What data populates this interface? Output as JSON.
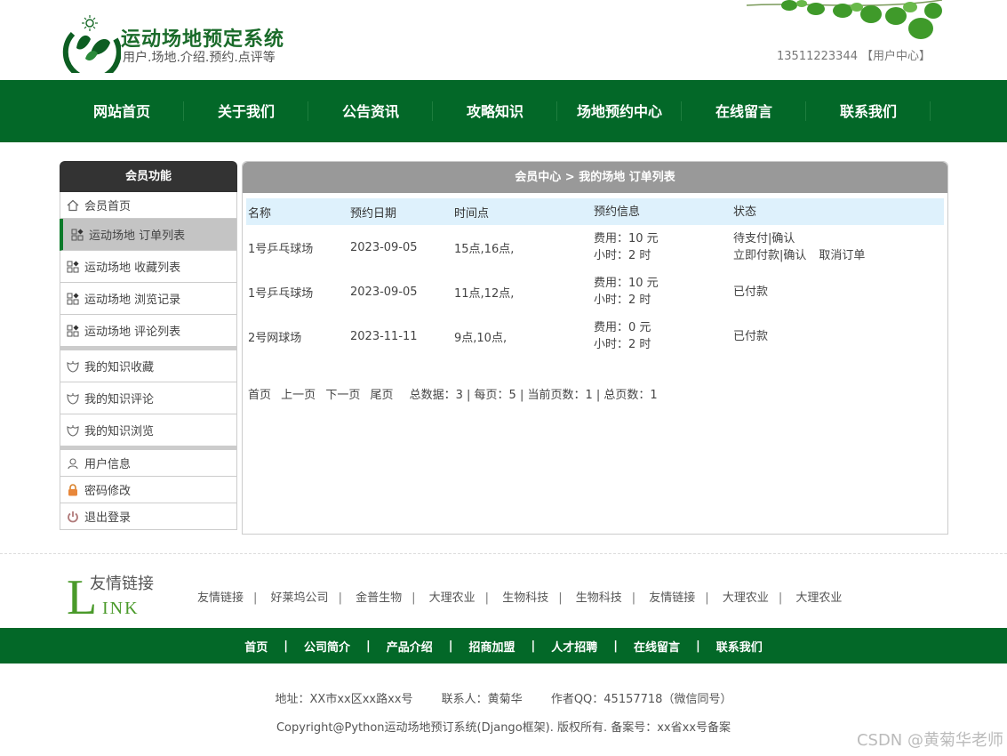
{
  "header": {
    "title": "运动场地预定系统",
    "subtitle": "用户.场地.介绍.预约.点评等",
    "phone": "13511223344",
    "user_center": "【用户中心】"
  },
  "nav": [
    "网站首页",
    "关于我们",
    "公告资讯",
    "攻略知识",
    "场地预约中心",
    "在线留言",
    "联系我们"
  ],
  "sidebar": {
    "title": "会员功能",
    "items": [
      {
        "label": "会员首页",
        "icon": "home-icon"
      },
      {
        "label": "运动场地 订单列表",
        "icon": "grid-icon"
      },
      {
        "label": "运动场地 收藏列表",
        "icon": "grid-icon"
      },
      {
        "label": "运动场地 浏览记录",
        "icon": "grid-icon"
      },
      {
        "label": "运动场地 评论列表",
        "icon": "grid-icon"
      },
      {
        "label": "我的知识收藏",
        "icon": "flower-icon"
      },
      {
        "label": "我的知识评论",
        "icon": "flower-icon"
      },
      {
        "label": "我的知识浏览",
        "icon": "flower-icon"
      },
      {
        "label": "用户信息",
        "icon": "user-icon"
      },
      {
        "label": "密码修改",
        "icon": "lock-icon"
      },
      {
        "label": "退出登录",
        "icon": "power-icon"
      }
    ]
  },
  "panel": {
    "title": "会员中心 > 我的场地 订单列表",
    "columns": [
      "名称",
      "预约日期",
      "时间点",
      "预约信息",
      "状态"
    ],
    "rows": [
      {
        "name": "1号乒乓球场",
        "date": "2023-09-05",
        "time": "15点,16点,",
        "fee": "费用：10 元",
        "hours": "小时：2 时",
        "status": "待支付|确认",
        "action1": "立即付款|确认",
        "action2": "取消订单"
      },
      {
        "name": "1号乒乓球场",
        "date": "2023-09-05",
        "time": "11点,12点,",
        "fee": "费用：10 元",
        "hours": "小时：2 时",
        "status": "已付款"
      },
      {
        "name": "2号网球场",
        "date": "2023-11-11",
        "time": "9点,10点,",
        "fee": "费用：0 元",
        "hours": "小时：2 时",
        "status": "已付款"
      }
    ],
    "pager": {
      "first": "首页",
      "prev": "上一页",
      "next": "下一页",
      "last": "尾页",
      "info": "总数据：3 | 每页：5 | 当前页数：1 | 总页数：1"
    }
  },
  "links": {
    "logo_text": "友情链接",
    "logo_link": "LINK",
    "items": [
      "友情链接",
      "好莱坞公司",
      "金普生物",
      "大理农业",
      "生物科技",
      "生物科技",
      "友情链接",
      "大理农业",
      "大理农业"
    ]
  },
  "footer_nav": [
    "首页",
    "公司简介",
    "产品介绍",
    "招商加盟",
    "人才招聘",
    "在线留言",
    "联系我们"
  ],
  "footer": {
    "address": "地址：XX市xx区xx路xx号",
    "contact": "联系人：黄菊华",
    "qq": "作者QQ：45157718（微信同号）",
    "copyright": "Copyright@Python运动场地预订系统(Django框架). 版权所有. 备案号：xx省xx号备案",
    "watermark": "CSDN @黄菊华老师"
  }
}
